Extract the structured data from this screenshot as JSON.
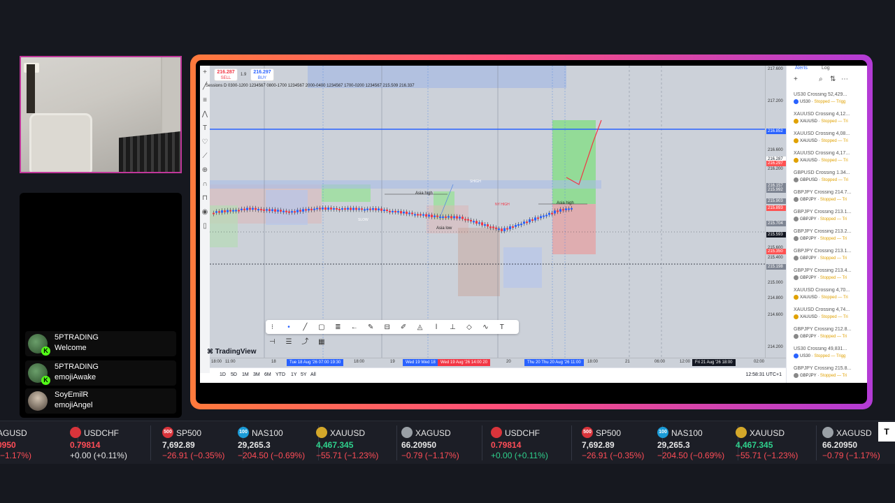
{
  "chat": [
    {
      "user": "5PTRADING",
      "text": "Welcome"
    },
    {
      "user": "5PTRADING",
      "text": "emojiAwake"
    },
    {
      "user": "SoyEmilR",
      "text": "emojiAngel"
    }
  ],
  "chart": {
    "sell_price": "216.287",
    "sell_label": "SELL",
    "spread": "1.9",
    "buy_price": "216.297",
    "buy_label": "BUY",
    "session_legend": "Sessions D 0300-1200 1234567 0800-1700 1234567 2000-0400 1234567 1700-0200 1234567 215.509 216.337",
    "logo": "TradingView",
    "annotations": [
      "Asia high",
      "Asia low",
      "NY HIGH",
      "Asia high",
      "SLOW",
      "SHIGH"
    ],
    "price_labels": [
      "217.600",
      "217.200",
      "216.600",
      "216.200",
      "215.600",
      "215.400",
      "215.000",
      "214.800",
      "214.600",
      "214.200"
    ],
    "price_tags": [
      {
        "v": "216.852",
        "c": "#2962ff"
      },
      {
        "v": "216.287",
        "c": "#ffffff"
      },
      {
        "v": "216.297",
        "c": "#ff5252"
      },
      {
        "v": "216.157",
        "c": "#7e8593"
      },
      {
        "v": "215.992",
        "c": "#7e8593"
      },
      {
        "v": "215.903",
        "c": "#7e8593"
      },
      {
        "v": "215.893",
        "c": "#ff5252"
      },
      {
        "v": "215.704",
        "c": "#7e8593"
      },
      {
        "v": "215.593",
        "c": "#131722"
      },
      {
        "v": "215.350",
        "c": "#ff5252"
      },
      {
        "v": "215.198",
        "c": "#7e8593"
      }
    ],
    "time_labels": [
      "18:00",
      "11:00",
      "18",
      "18:00",
      "19",
      "20",
      "18:00",
      "21",
      "06:00",
      "12:00",
      "02:00"
    ],
    "time_badges": [
      "Tue 18 Aug '26  07:00  19:30",
      "Wed 19  Wed 18",
      "Wed 19 Aug '26  14:00  20",
      "Thu 20  Thu 20 Aug '26  11:00",
      "Fri 21 Aug '26  18:00"
    ],
    "ranges": [
      "1D",
      "5D",
      "1M",
      "3M",
      "6M",
      "YTD",
      "1Y",
      "5Y",
      "All"
    ],
    "clock": "12:58:31 UTC+1"
  },
  "alerts": {
    "tabs": [
      "Alerts",
      "Log"
    ],
    "items": [
      {
        "title": "US30 Crossing 52,429...",
        "sym": "US30",
        "status": "Stopped — Trigg",
        "c": "#2962ff"
      },
      {
        "title": "XAUUSD Crossing 4,12...",
        "sym": "XAUUSD",
        "status": "Stopped — Tri",
        "c": "#e0a100"
      },
      {
        "title": "XAUUSD Crossing 4,08...",
        "sym": "XAUUSD",
        "status": "Stopped — Tri",
        "c": "#e0a100"
      },
      {
        "title": "XAUUSD Crossing 4,17...",
        "sym": "XAUUSD",
        "status": "Stopped — Tri",
        "c": "#e0a100"
      },
      {
        "title": "GBPUSD Crossing 1.34...",
        "sym": "GBPUSD",
        "status": "Stopped — Tri",
        "c": "#888"
      },
      {
        "title": "GBPJPY Crossing 214.7...",
        "sym": "GBPJPY",
        "status": "Stopped — Tri",
        "c": "#888"
      },
      {
        "title": "GBPJPY Crossing 213.1...",
        "sym": "GBPJPY",
        "status": "Stopped — Tri",
        "c": "#888"
      },
      {
        "title": "GBPJPY Crossing 213.2...",
        "sym": "GBPJPY",
        "status": "Stopped — Tri",
        "c": "#888"
      },
      {
        "title": "GBPJPY Crossing 213.1...",
        "sym": "GBPJPY",
        "status": "Stopped — Tri",
        "c": "#888"
      },
      {
        "title": "GBPJPY Crossing 213.4...",
        "sym": "GBPJPY",
        "status": "Stopped — Tri",
        "c": "#888"
      },
      {
        "title": "XAUUSD Crossing 4,70...",
        "sym": "XAUUSD",
        "status": "Stopped — Tri",
        "c": "#e0a100"
      },
      {
        "title": "XAUUSD Crossing 4,74...",
        "sym": "XAUUSD",
        "status": "Stopped — Tri",
        "c": "#e0a100"
      },
      {
        "title": "GBPJPY Crossing 212.8...",
        "sym": "GBPJPY",
        "status": "Stopped — Tri",
        "c": "#888"
      },
      {
        "title": "US30 Crossing 49,831...",
        "sym": "US30",
        "status": "Stopped — Trigg",
        "c": "#2962ff"
      },
      {
        "title": "GBPJPY Crossing 215.8...",
        "sym": "GBPJPY",
        "status": "Stopped — Tri",
        "c": "#888"
      }
    ]
  },
  "ticker": [
    {
      "sym": "AGUSD",
      "price": "0950",
      "chg": "(−1.17%)",
      "dir": "dn",
      "icon": "",
      "ic": "#888",
      "partial": true
    },
    {
      "sym": "USDCHF",
      "price": "0.79814",
      "chg": "+0.00 (+0.11%)",
      "dir": "nu",
      "pc": "dn",
      "icon": "",
      "ic": "#d9343b"
    },
    {
      "sym": "SP500",
      "price": "7,692.89",
      "chg": "−26.91 (−0.35%)",
      "dir": "dn",
      "pc": "nu",
      "icon": "500",
      "ic": "#d9343b"
    },
    {
      "sym": "NAS100",
      "price": "29,265.3",
      "chg": "−204.50 (−0.69%)",
      "dir": "dn",
      "pc": "nu",
      "icon": "100",
      "ic": "#1a9bd7"
    },
    {
      "sym": "XAUUSD",
      "price": "4,467.345",
      "chg": "−55.71 (−1.23%)",
      "dir": "dn",
      "pc": "up",
      "icon": "",
      "ic": "#d4a82a"
    },
    {
      "sym": "XAGUSD",
      "price": "66.20950",
      "chg": "−0.79 (−1.17%)",
      "dir": "dn",
      "pc": "nu",
      "icon": "",
      "ic": "#9aa0a6"
    },
    {
      "sym": "USDCHF",
      "price": "0.79814",
      "chg": "+0.00 (+0.11%)",
      "dir": "up",
      "pc": "dn",
      "icon": "",
      "ic": "#d9343b"
    },
    {
      "sym": "SP500",
      "price": "7,692.89",
      "chg": "−26.91 (−0.35%)",
      "dir": "dn",
      "pc": "nu",
      "icon": "500",
      "ic": "#d9343b"
    },
    {
      "sym": "NAS100",
      "price": "29,265.3",
      "chg": "−204.50 (−0.69%)",
      "dir": "dn",
      "pc": "nu",
      "icon": "100",
      "ic": "#1a9bd7"
    },
    {
      "sym": "XAUUSD",
      "price": "4,467.345",
      "chg": "−55.71 (−1.23%)",
      "dir": "dn",
      "pc": "up",
      "icon": "",
      "ic": "#d4a82a"
    },
    {
      "sym": "XAGUSD",
      "price": "66.20950",
      "chg": "−0.79 (−1.17%)",
      "dir": "dn",
      "pc": "nu",
      "icon": "",
      "ic": "#9aa0a6"
    }
  ]
}
